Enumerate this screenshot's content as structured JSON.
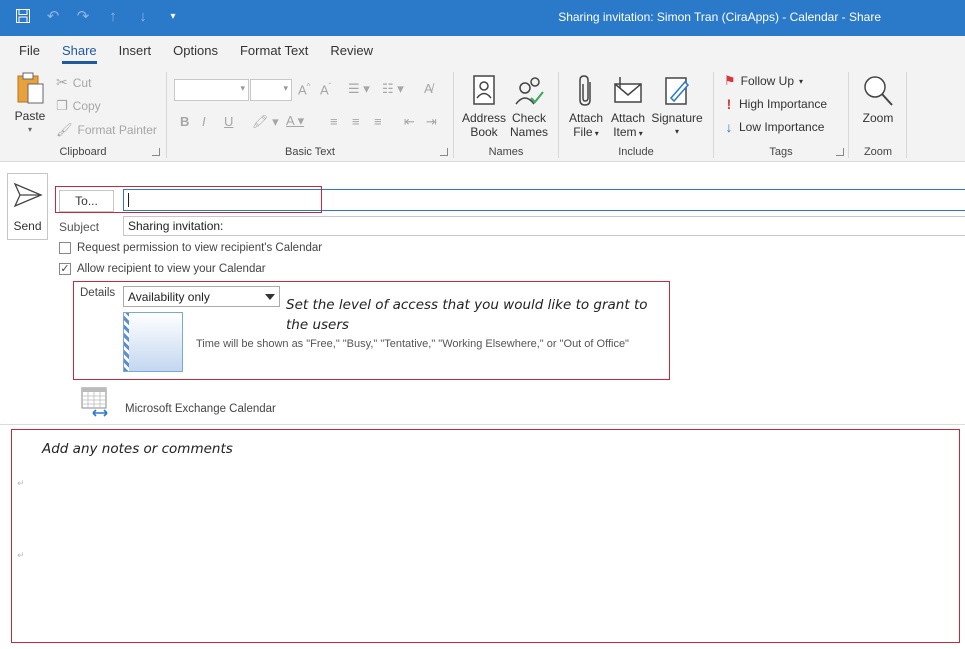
{
  "window": {
    "title": "Sharing invitation: Simon Tran (CiraApps) - Calendar  -  Share"
  },
  "tabs": [
    "File",
    "Share",
    "Insert",
    "Options",
    "Format Text",
    "Review"
  ],
  "active_tab": "Share",
  "ribbon": {
    "clipboard": {
      "label": "Clipboard",
      "paste": "Paste",
      "cut": "Cut",
      "copy": "Copy",
      "format_painter": "Format Painter"
    },
    "basic_text": {
      "label": "Basic Text",
      "bold": "B",
      "italic": "I",
      "underline": "U"
    },
    "names": {
      "label": "Names",
      "address_book_1": "Address",
      "address_book_2": "Book",
      "check_names_1": "Check",
      "check_names_2": "Names"
    },
    "include": {
      "label": "Include",
      "attach_file_1": "Attach",
      "attach_file_2": "File",
      "attach_item_1": "Attach",
      "attach_item_2": "Item",
      "signature": "Signature"
    },
    "tags": {
      "label": "Tags",
      "follow_up": "Follow Up",
      "high_importance": "High Importance",
      "low_importance": "Low Importance"
    },
    "zoom": {
      "label": "Zoom",
      "zoom_btn": "Zoom"
    }
  },
  "compose": {
    "send": "Send",
    "to_button": "To...",
    "to_value": "",
    "subject_label": "Subject",
    "subject_value": "Sharing invitation:",
    "request_permission": "Request permission to view recipient's Calendar",
    "request_permission_checked": false,
    "allow_recipient": "Allow recipient to view your Calendar",
    "allow_recipient_checked": true,
    "details_label": "Details",
    "details_value": "Availability only",
    "availability_desc": "Time will be shown as \"Free,\" \"Busy,\" \"Tentative,\" \"Working Elsewhere,\" or \"Out of Office\"",
    "exchange_calendar": "Microsoft Exchange Calendar"
  },
  "annotations": {
    "access_note": "Set the level of access that you would like to grant to the users",
    "notes_note": "Add any notes or comments"
  },
  "colors": {
    "titlebar": "#2b79c9",
    "annotation_box": "#c6283d",
    "ribbon_bg": "#f3f3f3"
  }
}
